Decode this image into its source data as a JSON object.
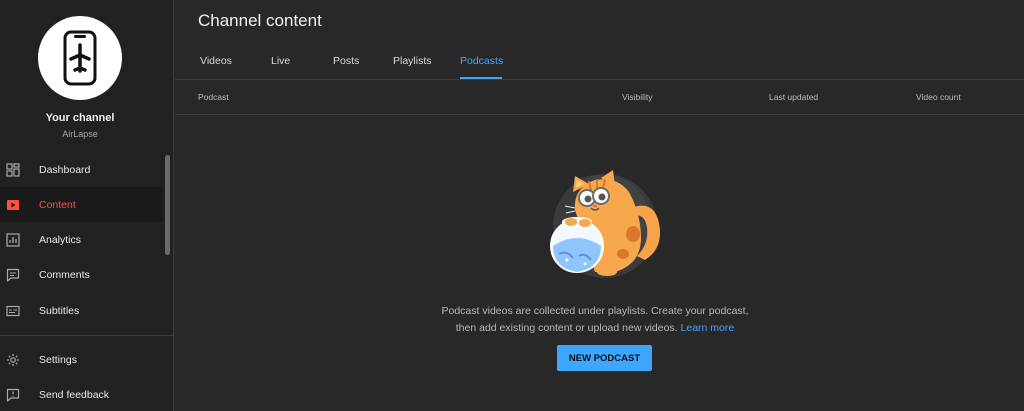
{
  "sidebar": {
    "channel_name": "Your channel",
    "channel_handle": "AirLapse",
    "items": [
      {
        "label": "Dashboard",
        "icon": "dashboard-icon"
      },
      {
        "label": "Content",
        "icon": "content-icon",
        "active": true
      },
      {
        "label": "Analytics",
        "icon": "analytics-icon"
      },
      {
        "label": "Comments",
        "icon": "comments-icon"
      },
      {
        "label": "Subtitles",
        "icon": "subtitles-icon"
      }
    ],
    "bottom_items": [
      {
        "label": "Settings",
        "icon": "gear-icon"
      },
      {
        "label": "Send feedback",
        "icon": "feedback-icon"
      }
    ]
  },
  "main": {
    "title": "Channel content",
    "tabs": [
      {
        "label": "Videos"
      },
      {
        "label": "Live"
      },
      {
        "label": "Posts"
      },
      {
        "label": "Playlists"
      },
      {
        "label": "Podcasts",
        "active": true
      }
    ],
    "columns": [
      "Podcast",
      "Visibility",
      "Last updated",
      "Video count"
    ],
    "empty_state": {
      "line1": "Podcast videos are collected under playlists. Create your podcast,",
      "line2": "then add existing content or upload new videos.",
      "link": "Learn more",
      "button": "NEW PODCAST"
    }
  },
  "colors": {
    "accent": "#3ea6ff",
    "active_nav": "#ff4e45",
    "background": "#282828",
    "sidebar": "#212121"
  }
}
